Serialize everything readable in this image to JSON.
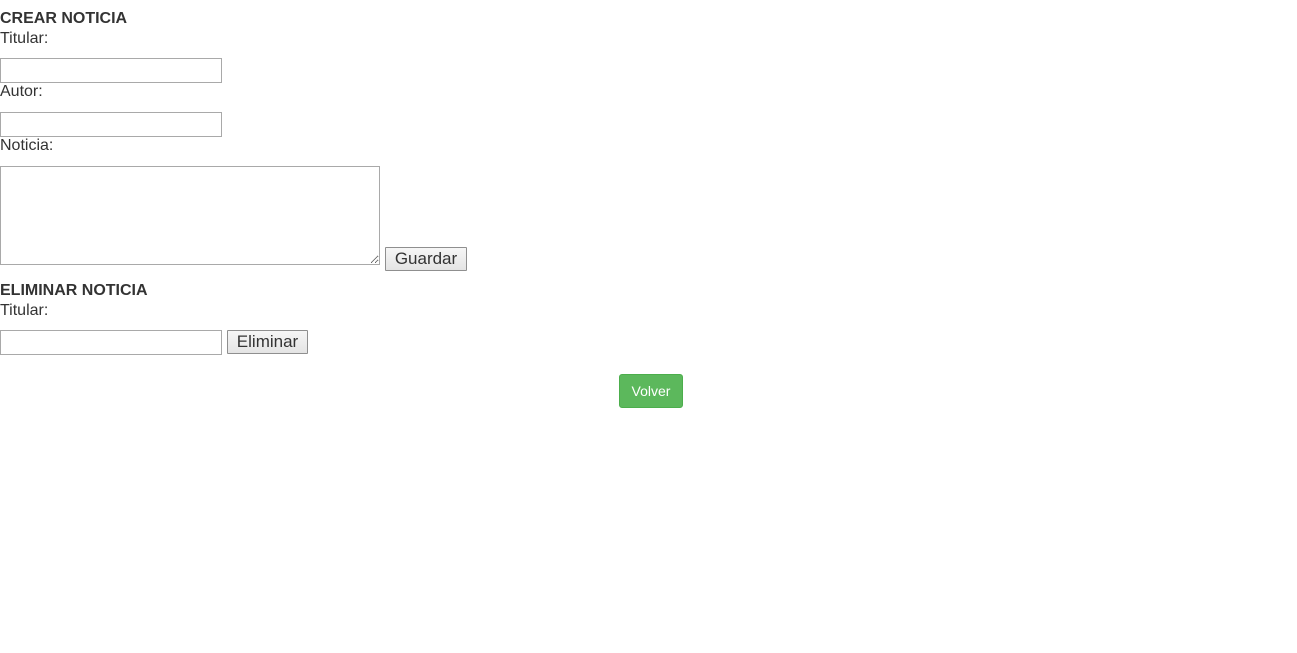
{
  "create": {
    "heading": "CREAR NOTICIA",
    "title_label": "Titular:",
    "title_value": "",
    "author_label": "Autor:",
    "author_value": "",
    "body_label": "Noticia:",
    "body_value": "",
    "save_label": "Guardar"
  },
  "delete": {
    "heading": "ELIMINAR NOTICIA",
    "title_label": "Titular:",
    "title_value": "",
    "delete_label": "Eliminar"
  },
  "back_label": "Volver",
  "colors": {
    "text": "#333333",
    "back_button": "#5cb85c",
    "back_button_text": "#ffffff"
  }
}
